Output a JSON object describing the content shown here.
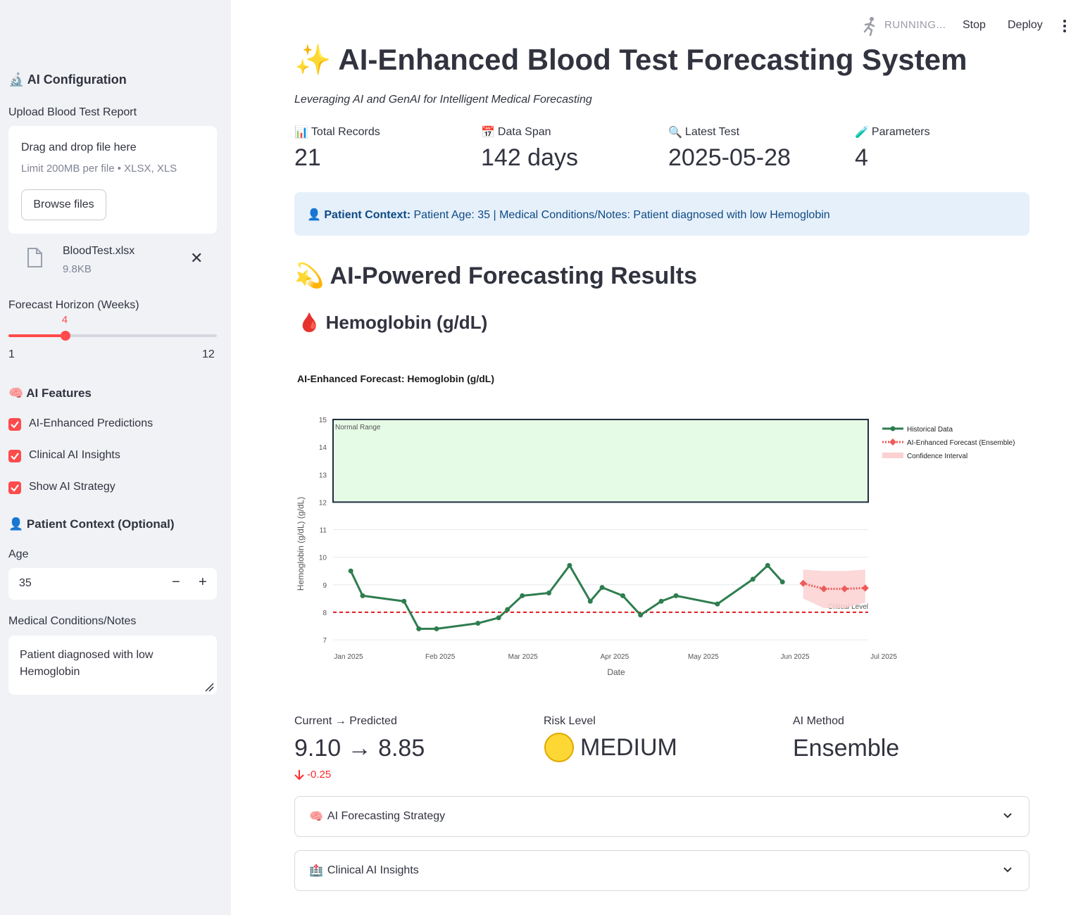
{
  "sidebar": {
    "config_title": "AI Configuration",
    "upload_label": "Upload Blood Test Report",
    "upload": {
      "drag_text": "Drag and drop file here",
      "limit_text": "Limit 200MB per file • XLSX, XLS",
      "browse_label": "Browse files"
    },
    "file": {
      "name": "BloodTest.xlsx",
      "size": "9.8KB"
    },
    "forecast_label": "Forecast Horizon (Weeks)",
    "slider": {
      "value": "4",
      "min": "1",
      "max": "12",
      "fraction": 0.2727
    },
    "features_title": "AI Features",
    "features": [
      {
        "label": "AI-Enhanced Predictions",
        "checked": true
      },
      {
        "label": "Clinical AI Insights",
        "checked": true
      },
      {
        "label": "Show AI Strategy",
        "checked": true
      }
    ],
    "patient_title": "Patient Context (Optional)",
    "age_label": "Age",
    "age_value": "35",
    "notes_label": "Medical Conditions/Notes",
    "notes_value": "Patient diagnosed with  low Hemoglobin"
  },
  "topbar": {
    "status": "RUNNING...",
    "stop": "Stop",
    "deploy": "Deploy"
  },
  "main": {
    "title": "AI-Enhanced Blood Test Forecasting System",
    "subtitle": "Leveraging AI and GenAI for Intelligent Medical Forecasting",
    "metrics": [
      {
        "label": "Total Records",
        "value": "21",
        "icon": "bar-chart-icon"
      },
      {
        "label": "Data Span",
        "value": "142 days",
        "icon": "calendar-icon"
      },
      {
        "label": "Latest Test",
        "value": "2025-05-28",
        "icon": "magnifier-icon"
      },
      {
        "label": "Parameters",
        "value": "4",
        "icon": "test-tube-icon"
      }
    ],
    "context_label": "Patient Context:",
    "context_text": "Patient Age: 35 | Medical Conditions/Notes: Patient diagnosed with low Hemoglobin",
    "results_title": "AI-Powered Forecasting Results",
    "param_title": "Hemoglobin (g/dL)",
    "stats": {
      "current_label": "Current → Predicted",
      "current_value": "9.10 → 8.85",
      "delta": "-0.25",
      "risk_label": "Risk Level",
      "risk_value": "MEDIUM",
      "method_label": "AI Method",
      "method_value": "Ensemble"
    },
    "expanders": [
      {
        "label": "AI Forecasting Strategy",
        "icon": "brain-icon"
      },
      {
        "label": "Clinical AI Insights",
        "icon": "hospital-icon"
      }
    ]
  },
  "chart_data": {
    "type": "line",
    "title": "AI-Enhanced Forecast: Hemoglobin (g/dL)",
    "xlabel": "Date",
    "ylabel": "Hemoglobin (g/dL) (g/dL)",
    "ylim": [
      7,
      15
    ],
    "yticks": [
      7,
      8,
      9,
      10,
      11,
      12,
      13,
      14,
      15
    ],
    "xticks": [
      {
        "label": "Jan 2025",
        "date": "2025-01-01"
      },
      {
        "label": "Feb 2025",
        "date": "2025-02-01"
      },
      {
        "label": "Mar 2025",
        "date": "2025-03-01"
      },
      {
        "label": "Apr 2025",
        "date": "2025-04-01"
      },
      {
        "label": "May 2025",
        "date": "2025-05-01"
      },
      {
        "label": "Jun 2025",
        "date": "2025-06-01"
      },
      {
        "label": "Jul 2025",
        "date": "2025-07-01"
      }
    ],
    "xlim": [
      "2025-01-01",
      "2025-07-01"
    ],
    "normal_range": {
      "low": 12,
      "high": 15,
      "label": "Normal Range"
    },
    "critical_level": {
      "value": 8,
      "label": "Critical Level"
    },
    "legend_position": "right",
    "series": [
      {
        "name": "Historical Data",
        "color": "#2e7d4f",
        "points": [
          [
            "2025-01-07",
            9.5
          ],
          [
            "2025-01-11",
            8.6
          ],
          [
            "2025-01-25",
            8.4
          ],
          [
            "2025-01-30",
            7.4
          ],
          [
            "2025-02-05",
            7.4
          ],
          [
            "2025-02-19",
            7.6
          ],
          [
            "2025-02-26",
            7.8
          ],
          [
            "2025-03-01",
            8.1
          ],
          [
            "2025-03-06",
            8.6
          ],
          [
            "2025-03-15",
            8.7
          ],
          [
            "2025-03-22",
            9.7
          ],
          [
            "2025-03-29",
            8.4
          ],
          [
            "2025-04-02",
            8.9
          ],
          [
            "2025-04-09",
            8.6
          ],
          [
            "2025-04-15",
            7.9
          ],
          [
            "2025-04-22",
            8.4
          ],
          [
            "2025-04-27",
            8.6
          ],
          [
            "2025-05-11",
            8.3
          ],
          [
            "2025-05-23",
            9.2
          ],
          [
            "2025-05-28",
            9.7
          ],
          [
            "2025-06-02",
            9.1
          ]
        ]
      },
      {
        "name": "AI-Enhanced Forecast (Ensemble)",
        "color": "#ef5a5a",
        "points": [
          [
            "2025-06-09",
            9.05
          ],
          [
            "2025-06-16",
            8.85
          ],
          [
            "2025-06-23",
            8.85
          ],
          [
            "2025-06-30",
            8.88
          ]
        ]
      },
      {
        "name": "Confidence Interval",
        "color": "#fbd1d1",
        "upper": [
          9.55,
          9.5,
          9.5,
          9.55
        ],
        "lower": [
          8.5,
          8.15,
          8.15,
          8.35
        ]
      }
    ]
  }
}
